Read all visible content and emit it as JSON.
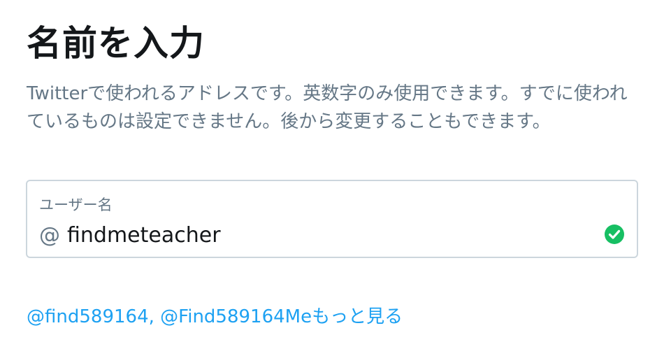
{
  "page": {
    "title": "名前を入力",
    "description": "Twitterで使われるアドレスです。英数字のみ使用できます。すでに使われているものは設定できません。後から変更することもできます。"
  },
  "username_field": {
    "label": "ユーザー名",
    "prefix": "@",
    "value": "findmeteacher",
    "status_icon": "check-circle-icon",
    "status_color": "#17bf63"
  },
  "suggestions": {
    "items": [
      "@find589164",
      "@Find589164Me"
    ],
    "separator": ", ",
    "more_label": "もっと見る"
  },
  "colors": {
    "text_primary": "#14171a",
    "text_secondary": "#657786",
    "accent": "#1da1f2",
    "border": "#ccd6dd",
    "success": "#17bf63"
  }
}
